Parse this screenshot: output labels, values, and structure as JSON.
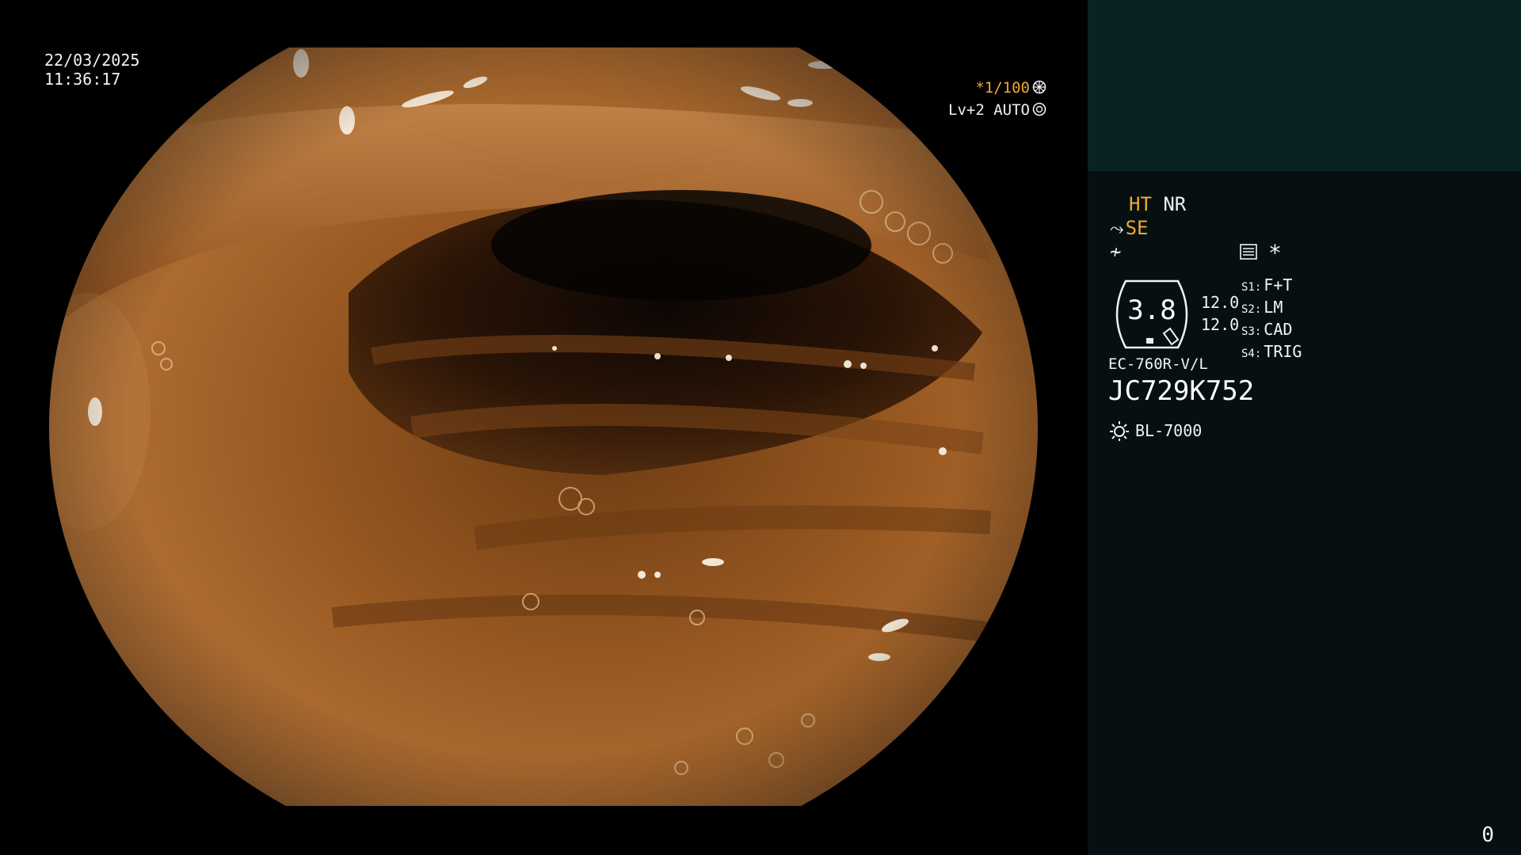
{
  "overlay": {
    "date": "22/03/2025",
    "time": "11:36:17",
    "shutter": "*1/100",
    "iris": "Lv+2 AUTO"
  },
  "panel": {
    "ht": "HT",
    "nr": "NR",
    "se": "SE",
    "zoom_value": "3.8",
    "lens_top": "12.0",
    "lens_bottom": "12.0",
    "switches": [
      {
        "key": "S1:",
        "label": "F+T"
      },
      {
        "key": "S2:",
        "label": "LM"
      },
      {
        "key": "S3:",
        "label": "CAD"
      },
      {
        "key": "S4:",
        "label": "TRIG"
      }
    ],
    "scope_model": "EC-760R-V/L",
    "serial": "JC729K752",
    "light_source": "BL-7000",
    "page_number": "0"
  },
  "colors": {
    "accent_orange": "#f0a830",
    "panel_bg": "#061012",
    "panel_top_bg": "#0b2224",
    "tissue": "#a8652a"
  },
  "icons": [
    "shutter-icon",
    "iris-icon",
    "enhance-icon",
    "menu-icon",
    "star-icon",
    "gauge-icon",
    "light-icon"
  ]
}
